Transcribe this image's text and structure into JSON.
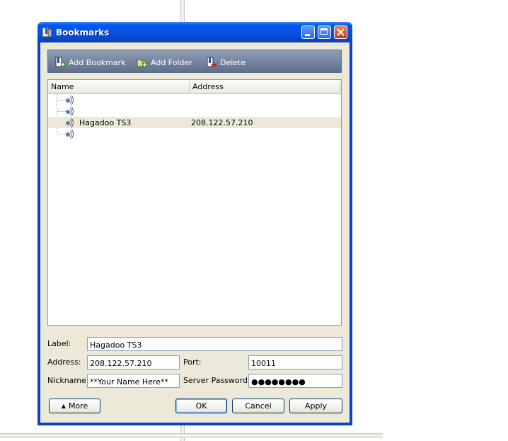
{
  "window": {
    "title": "Bookmarks"
  },
  "toolbar": {
    "add_bookmark": "Add Bookmark",
    "add_folder": "Add Folder",
    "delete": "Delete"
  },
  "tree": {
    "columns": {
      "name": "Name",
      "address": "Address"
    },
    "rows": [
      {
        "name": "",
        "address": ""
      },
      {
        "name": "",
        "address": ""
      },
      {
        "name": "Hagadoo TS3",
        "address": "208.122.57.210",
        "selected": true
      },
      {
        "name": "",
        "address": ""
      }
    ]
  },
  "form": {
    "label_caption": "Label:",
    "label_value": "Hagadoo TS3",
    "address_caption": "Address:",
    "address_value": "208.122.57.210",
    "port_caption": "Port:",
    "port_value": "10011",
    "nickname_caption": "Nickname:",
    "nickname_value": "**Your Name Here**",
    "password_caption": "Server Password:",
    "password_value": "●●●●●●●●"
  },
  "buttons": {
    "more": "More",
    "more_arrow": "▲",
    "ok": "OK",
    "cancel": "Cancel",
    "apply": "Apply"
  },
  "colors": {
    "titlebar": "#0058ee",
    "client_bg": "#ece9d8",
    "toolbar": "#6f7f9a"
  }
}
